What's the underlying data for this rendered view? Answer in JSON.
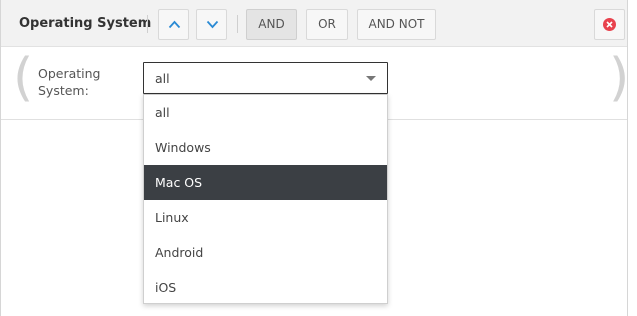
{
  "header": {
    "title": "Operating System",
    "buttons": {
      "and": "AND",
      "or": "OR",
      "and_not": "AND NOT"
    },
    "icons": [
      "chevron-up-icon",
      "chevron-down-icon",
      "close-circle-icon"
    ]
  },
  "condition": {
    "open_paren": "(",
    "close_paren": ")",
    "label": "Operating System:",
    "select_value": "all"
  },
  "dropdown": {
    "options": [
      "all",
      "Windows",
      "Mac OS",
      "Linux",
      "Android",
      "iOS"
    ],
    "highlighted": "Mac OS"
  },
  "colors": {
    "accent": "#2a8ad4",
    "highlight_bg": "#3b3f44",
    "close_red": "#e8424d"
  }
}
